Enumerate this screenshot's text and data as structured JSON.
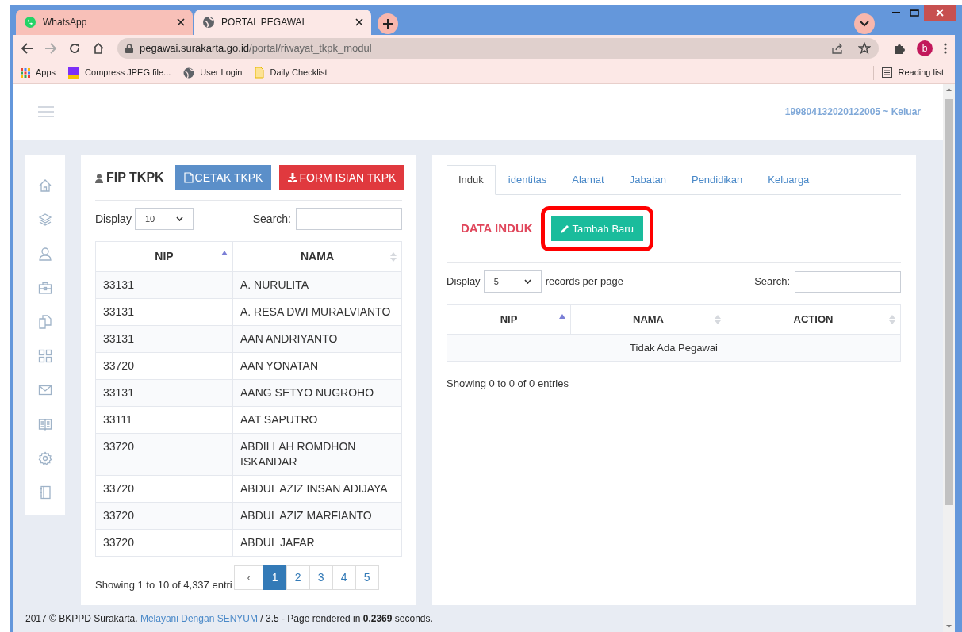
{
  "browser": {
    "tabs": [
      {
        "title": "WhatsApp",
        "kind": "whatsapp",
        "selected": false
      },
      {
        "title": "PORTAL PEGAWAI",
        "kind": "globe",
        "selected": true
      }
    ],
    "address": {
      "domain": "pegawai.surakarta.go.id",
      "path": "/portal/riwayat_tkpk_modul"
    },
    "profile_initial": "b",
    "bookmarks": [
      {
        "label": "Apps",
        "kind": "apps"
      },
      {
        "label": "Compress JPEG file...",
        "kind": "jpeg"
      },
      {
        "label": "User Login",
        "kind": "globe"
      },
      {
        "label": "Daily Checklist",
        "kind": "folder"
      }
    ],
    "reading_list": "Reading list"
  },
  "header": {
    "user": "199804132020122005 ~ Keluar"
  },
  "left_panel": {
    "title": "FIP TKPK",
    "buttons": [
      {
        "label": "CETAK TKPK",
        "kind": "print"
      },
      {
        "label": "FORM ISIAN TKPK",
        "kind": "download"
      }
    ],
    "display_label": "Display",
    "display_value": "10",
    "search_label": "Search:",
    "table": {
      "columns": [
        {
          "label": "NIP",
          "sorted": true
        },
        {
          "label": "NAMA",
          "sorted": false
        }
      ],
      "rows": [
        [
          "33131",
          "A. NURULITA"
        ],
        [
          "33131",
          "A. RESA DWI MURALVIANTO"
        ],
        [
          "33131",
          "AAN ANDRIYANTO"
        ],
        [
          "33720",
          "AAN YONATAN"
        ],
        [
          "33131",
          "AANG SETYO NUGROHO"
        ],
        [
          "33111",
          "AAT SAPUTRO"
        ],
        [
          "33720",
          "ABDILLAH ROMDHON ISKANDAR"
        ],
        [
          "33720",
          "ABDUL AZIZ INSAN ADIJAYA"
        ],
        [
          "33720",
          "ABDUL AZIZ MARFIANTO"
        ],
        [
          "33720",
          "ABDUL JAFAR"
        ]
      ]
    },
    "info": "Showing 1 to 10 of 4,337 entri",
    "pagination": [
      {
        "label": "‹",
        "selected": false
      },
      {
        "label": "1",
        "selected": true
      },
      {
        "label": "2",
        "selected": false
      },
      {
        "label": "3",
        "selected": false
      },
      {
        "label": "4",
        "selected": false
      },
      {
        "label": "5",
        "selected": false
      }
    ]
  },
  "right_panel": {
    "tabs": [
      {
        "label": "Induk",
        "selected": true
      },
      {
        "label": "identitas",
        "selected": false
      },
      {
        "label": "Alamat",
        "selected": false
      },
      {
        "label": "Jabatan",
        "selected": false
      },
      {
        "label": "Pendidikan",
        "selected": false
      },
      {
        "label": "Keluarga",
        "selected": false
      }
    ],
    "section_title": "DATA INDUK",
    "add_button": "Tambah Baru",
    "add_button_highlighted": true,
    "display_label": "Display",
    "display_value": "5",
    "display_suffix": "records per page",
    "search_label": "Search:",
    "table": {
      "columns": [
        {
          "label": "NIP",
          "sorted": true
        },
        {
          "label": "NAMA",
          "sorted": false
        },
        {
          "label": "ACTION",
          "sorted": false
        }
      ],
      "empty_message": "Tidak Ada Pegawai"
    },
    "info": "Showing 0 to 0 of 0 entries"
  },
  "footer": {
    "prefix": "2017 © BKPPD Surakarta.",
    "link": "Melayani Dengan SENYUM",
    "suffix": "/ 3.5 - Page rendered in **0.2369** seconds."
  }
}
